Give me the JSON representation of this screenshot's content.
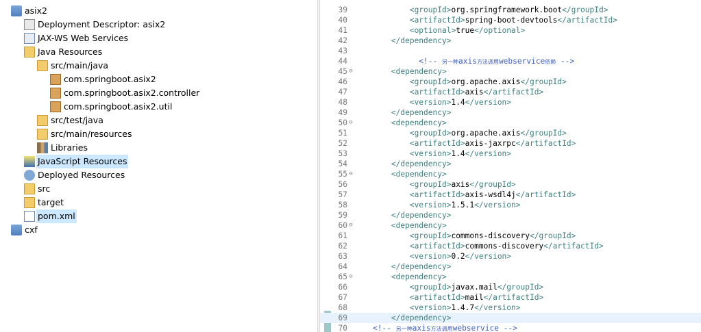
{
  "explorer": {
    "rows": [
      {
        "label": "asix2",
        "arrow": "✓",
        "icon": "maven-project-icon"
      },
      {
        "label": "Deployment Descriptor: asix2",
        "arrow": "›",
        "icon": "deployment-descriptor-icon"
      },
      {
        "label": "JAX-WS Web Services",
        "arrow": "›",
        "icon": "web-services-icon"
      },
      {
        "label": "Java Resources",
        "arrow": "⌄",
        "icon": "java-resources-icon"
      },
      {
        "label": "src/main/java",
        "arrow": "⌄",
        "icon": "source-folder-icon"
      },
      {
        "label": "com.springboot.asix2",
        "arrow": "›",
        "icon": "package-icon"
      },
      {
        "label": "com.springboot.asix2.controller",
        "arrow": "›",
        "icon": "package-icon"
      },
      {
        "label": "com.springboot.asix2.util",
        "arrow": "›",
        "icon": "package-icon"
      },
      {
        "label": "src/test/java",
        "arrow": "›",
        "icon": "source-folder-icon"
      },
      {
        "label": "src/main/resources",
        "arrow": "›",
        "icon": "source-folder-icon"
      },
      {
        "label": "Libraries",
        "arrow": "›",
        "icon": "libraries-icon"
      },
      {
        "label": "JavaScript Resources",
        "arrow": "›",
        "icon": "javascript-resources-icon"
      },
      {
        "label": "Deployed Resources",
        "arrow": "›",
        "icon": "deployed-resources-icon"
      },
      {
        "label": "src",
        "arrow": "›",
        "icon": "folder-icon"
      },
      {
        "label": "target",
        "arrow": "›",
        "icon": "folder-icon"
      },
      {
        "label": "pom.xml",
        "arrow": "",
        "icon": "pom-file-icon"
      },
      {
        "label": "cxf",
        "arrow": "›",
        "icon": "maven-project-icon"
      }
    ]
  },
  "editor": {
    "lines": [
      {
        "n": "39",
        "code": "            <groupId>org.springframework.boot</groupId>"
      },
      {
        "n": "40",
        "code": "            <artifactId>spring-boot-devtools</artifactId>"
      },
      {
        "n": "41",
        "code": "            <optional>true</optional>"
      },
      {
        "n": "42",
        "code": "        </dependency>"
      },
      {
        "n": "43",
        "code": ""
      },
      {
        "n": "44",
        "code": "              <!-- 另一种axis方法调用webservice依赖 -->"
      },
      {
        "n": "45",
        "code": "        <dependency>",
        "fold": "⊖"
      },
      {
        "n": "46",
        "code": "            <groupId>org.apache.axis</groupId>"
      },
      {
        "n": "47",
        "code": "            <artifactId>axis</artifactId>"
      },
      {
        "n": "48",
        "code": "            <version>1.4</version>"
      },
      {
        "n": "49",
        "code": "        </dependency>"
      },
      {
        "n": "50",
        "code": "        <dependency>",
        "fold": "⊖"
      },
      {
        "n": "51",
        "code": "            <groupId>org.apache.axis</groupId>"
      },
      {
        "n": "52",
        "code": "            <artifactId>axis-jaxrpc</artifactId>"
      },
      {
        "n": "53",
        "code": "            <version>1.4</version>"
      },
      {
        "n": "54",
        "code": "        </dependency>"
      },
      {
        "n": "55",
        "code": "        <dependency>",
        "fold": "⊖"
      },
      {
        "n": "56",
        "code": "            <groupId>axis</groupId>"
      },
      {
        "n": "57",
        "code": "            <artifactId>axis-wsdl4j</artifactId>"
      },
      {
        "n": "58",
        "code": "            <version>1.5.1</version>"
      },
      {
        "n": "59",
        "code": "        </dependency>"
      },
      {
        "n": "60",
        "code": "        <dependency>",
        "fold": "⊖"
      },
      {
        "n": "61",
        "code": "            <groupId>commons-discovery</groupId>"
      },
      {
        "n": "62",
        "code": "            <artifactId>commons-discovery</artifactId>"
      },
      {
        "n": "63",
        "code": "            <version>0.2</version>"
      },
      {
        "n": "64",
        "code": "        </dependency>"
      },
      {
        "n": "65",
        "code": "        <dependency>",
        "fold": "⊖"
      },
      {
        "n": "66",
        "code": "            <groupId>javax.mail</groupId>"
      },
      {
        "n": "67",
        "code": "            <artifactId>mail</artifactId>"
      },
      {
        "n": "68",
        "code": "            <version>1.4.7</version>"
      },
      {
        "n": "69",
        "code": "        </dependency>",
        "current": true
      },
      {
        "n": "70",
        "code": "    <!-- 另一种axis方法调用webservice -->"
      }
    ]
  },
  "colors": {
    "tag": "#3f7f7f",
    "comment": "#3f5fbf",
    "selection": "#cce8ff",
    "current_line": "#e8f2fe"
  }
}
